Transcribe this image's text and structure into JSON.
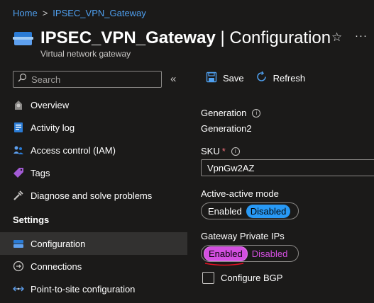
{
  "breadcrumb": {
    "home": "Home",
    "separator": ">",
    "current": "IPSEC_VPN_Gateway"
  },
  "header": {
    "name": "IPSEC_VPN_Gateway",
    "suffix": " | Configuration",
    "subtitle": "Virtual network gateway",
    "star_icon": "☆",
    "more_icon": "···"
  },
  "search": {
    "placeholder": "Search",
    "collapse_icon": "«"
  },
  "nav": {
    "items": [
      {
        "label": "Overview",
        "icon": "overview-icon"
      },
      {
        "label": "Activity log",
        "icon": "activity-log-icon"
      },
      {
        "label": "Access control (IAM)",
        "icon": "iam-icon"
      },
      {
        "label": "Tags",
        "icon": "tag-icon"
      },
      {
        "label": "Diagnose and solve problems",
        "icon": "wrench-icon"
      }
    ],
    "section": "Settings",
    "settings_items": [
      {
        "label": "Configuration",
        "icon": "configuration-icon",
        "active": true
      },
      {
        "label": "Connections",
        "icon": "connections-icon"
      },
      {
        "label": "Point-to-site configuration",
        "icon": "point-to-site-icon"
      }
    ]
  },
  "toolbar": {
    "save": "Save",
    "refresh": "Refresh"
  },
  "form": {
    "generation_label": "Generation",
    "generation_value": "Generation2",
    "sku_label": "SKU",
    "sku_required": "*",
    "sku_value": "VpnGw2AZ",
    "active_active_label": "Active-active mode",
    "active_active_enabled": "Enabled",
    "active_active_disabled": "Disabled",
    "private_ips_label": "Gateway Private IPs",
    "private_ips_enabled": "Enabled",
    "private_ips_disabled": "Disabled",
    "bgp_label": "Configure BGP",
    "info_icon": "i"
  },
  "colors": {
    "background": "#1b1a19",
    "link": "#4fa0f0",
    "toggle_selected": "#2899f5",
    "private_ip_highlight": "#d34fe0",
    "annotation_underline": "#e81123"
  }
}
